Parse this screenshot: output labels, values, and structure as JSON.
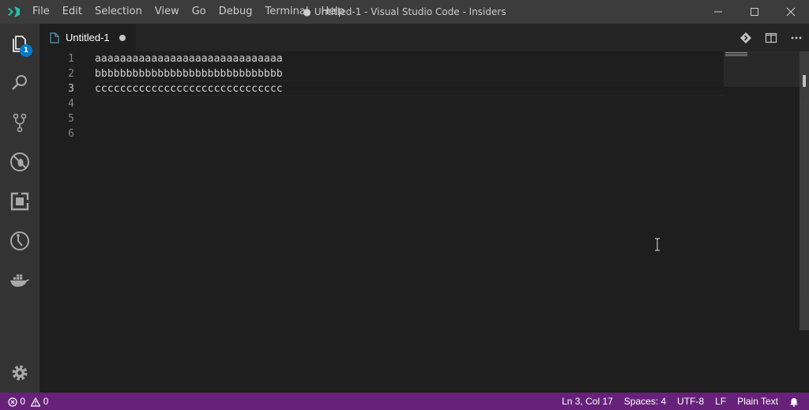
{
  "titlebar": {
    "menu": [
      "File",
      "Edit",
      "Selection",
      "View",
      "Go",
      "Debug",
      "Terminal",
      "Help"
    ],
    "dirty_dot": "●",
    "title": "Untitled-1 - Visual Studio Code - Insiders"
  },
  "activitybar": {
    "items": [
      "explorer-icon",
      "search-icon",
      "source-control-icon",
      "debug-icon",
      "extensions-icon",
      "remote-icon",
      "docker-icon"
    ],
    "explorer_badge": "1",
    "settings": "gear-icon"
  },
  "tabs": [
    {
      "label": "Untitled-1",
      "dirty": true
    }
  ],
  "editor": {
    "line_numbers": [
      "1",
      "2",
      "3",
      "4",
      "5",
      "6"
    ],
    "lines": [
      "aaaaaaaaaaaaaaaaaaaaaaaaaaaaaa",
      "bbbbbbbbbbbbbbbbbbbbbbbbbbbbbb",
      "cccccccccccccccccccccccccccccc",
      "",
      "",
      ""
    ],
    "active_line": 3
  },
  "statusbar": {
    "errors": "0",
    "warnings": "0",
    "cursor_position": "Ln 3, Col 17",
    "indentation": "Spaces: 4",
    "encoding": "UTF-8",
    "eol": "LF",
    "language": "Plain Text"
  },
  "colors": {
    "statusbar": "#68217a",
    "activitybar": "#333333",
    "titlebar": "#3c3c3c",
    "editor": "#1e1e1e",
    "badge": "#007acc",
    "logo": "#24bfa5"
  }
}
